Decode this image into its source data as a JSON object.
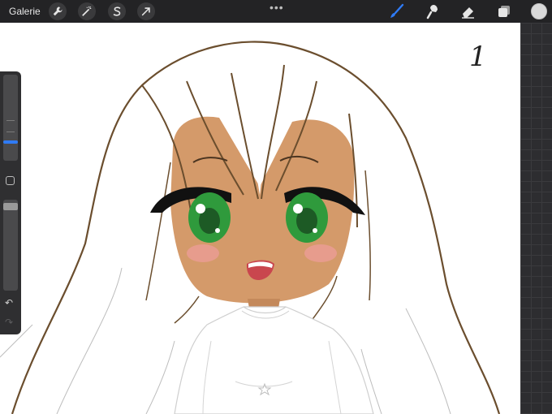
{
  "topbar": {
    "gallery_label": "Galerie",
    "actions": [
      {
        "name": "actions-wrench",
        "icon": "wrench-icon"
      },
      {
        "name": "adjustments",
        "icon": "magic-wand-icon"
      },
      {
        "name": "selection",
        "icon": "selection-s-icon"
      },
      {
        "name": "transform",
        "icon": "arrow-cursor-icon"
      }
    ],
    "more": "•••",
    "tools": [
      {
        "name": "brush",
        "icon": "brush-icon",
        "active": true
      },
      {
        "name": "smudge",
        "icon": "smudge-icon",
        "active": false
      },
      {
        "name": "eraser",
        "icon": "eraser-icon",
        "active": false
      },
      {
        "name": "layers",
        "icon": "layers-icon",
        "active": false
      }
    ],
    "color": "#d9d9d9"
  },
  "canvas": {
    "page_number": "1"
  },
  "sidebar": {
    "brush_size": 0.3,
    "opacity": 0.95,
    "undo": "↶",
    "redo": "↷"
  },
  "colors": {
    "accent": "#2f7bf5",
    "hair_line": "#6b4e2e",
    "skin": "#d49a6a",
    "eye_green": "#2f9a3c"
  }
}
